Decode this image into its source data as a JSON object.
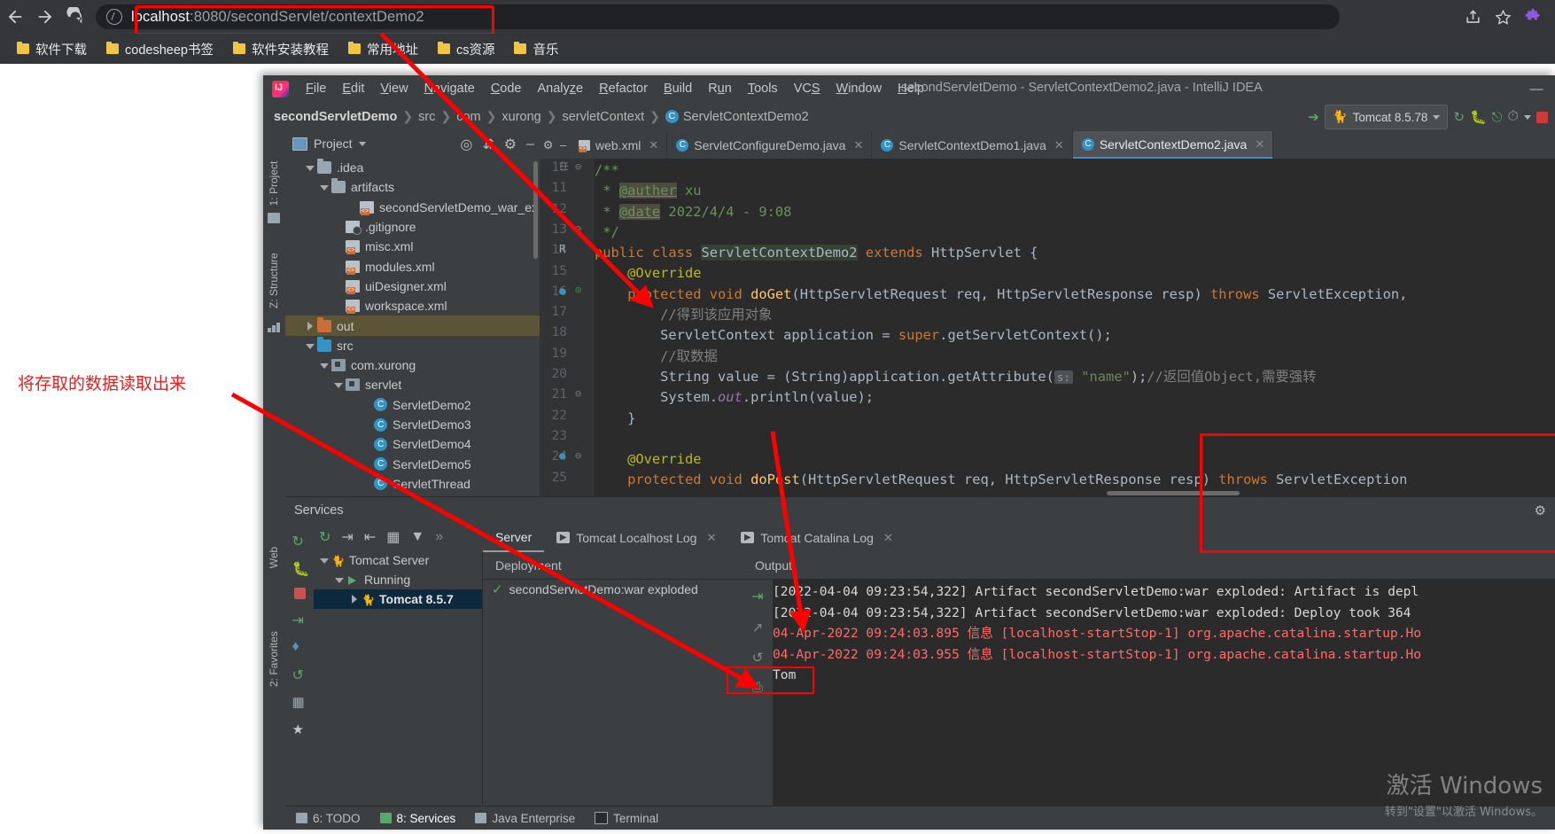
{
  "browser": {
    "back_icon": "back-arrow-icon",
    "forward_icon": "forward-arrow-icon",
    "reload_icon": "reload-icon",
    "url_host": "localhost",
    "url_rest": ":8080/secondServlet/contextDemo2",
    "share_icon": "share-icon",
    "bookmark_star_icon": "star-icon",
    "extensions_icon": "puzzle-icon",
    "bookmarks": [
      {
        "label": "软件下载"
      },
      {
        "label": "codesheep书签"
      },
      {
        "label": "软件安装教程"
      },
      {
        "label": "常用地址"
      },
      {
        "label": "cs资源"
      },
      {
        "label": "音乐"
      }
    ]
  },
  "ide": {
    "title": "secondServletDemo - ServletContextDemo2.java - IntelliJ IDEA",
    "minimize_label": "—",
    "menu": [
      {
        "label": "File",
        "mnemonic": "F"
      },
      {
        "label": "Edit",
        "mnemonic": "E"
      },
      {
        "label": "View",
        "mnemonic": "V"
      },
      {
        "label": "Navigate",
        "mnemonic": "N"
      },
      {
        "label": "Code",
        "mnemonic": "C"
      },
      {
        "label": "Analyze",
        "mnemonic": "z"
      },
      {
        "label": "Refactor",
        "mnemonic": "R"
      },
      {
        "label": "Build",
        "mnemonic": "B"
      },
      {
        "label": "Run",
        "mnemonic": "u"
      },
      {
        "label": "Tools",
        "mnemonic": "T"
      },
      {
        "label": "VCS",
        "mnemonic": "S"
      },
      {
        "label": "Window",
        "mnemonic": "W"
      },
      {
        "label": "Help",
        "mnemonic": "H"
      }
    ],
    "breadcrumb": [
      "secondServletDemo",
      "src",
      "com",
      "xurong",
      "servletContext",
      "ServletContextDemo2"
    ],
    "run_config": "Tomcat 8.5.78",
    "left_strips": [
      "1: Project",
      "Z: Structure"
    ],
    "bottom_left_strips": [
      "Web",
      "2: Favorites"
    ]
  },
  "project": {
    "title": "Project",
    "tree": [
      {
        "label": ".idea",
        "indent": 1,
        "arrow": "down",
        "icon": "folder"
      },
      {
        "label": "artifacts",
        "indent": 2,
        "arrow": "down",
        "icon": "folder"
      },
      {
        "label": "secondServletDemo_war_ex",
        "indent": 4,
        "arrow": "none",
        "icon": "xml"
      },
      {
        "label": ".gitignore",
        "indent": 3,
        "arrow": "none",
        "icon": "git"
      },
      {
        "label": "misc.xml",
        "indent": 3,
        "arrow": "none",
        "icon": "xml"
      },
      {
        "label": "modules.xml",
        "indent": 3,
        "arrow": "none",
        "icon": "xml"
      },
      {
        "label": "uiDesigner.xml",
        "indent": 3,
        "arrow": "none",
        "icon": "xml"
      },
      {
        "label": "workspace.xml",
        "indent": 3,
        "arrow": "none",
        "icon": "xml"
      },
      {
        "label": "out",
        "indent": 1,
        "arrow": "right",
        "icon": "folder-orange",
        "selected": true
      },
      {
        "label": "src",
        "indent": 1,
        "arrow": "down",
        "icon": "folder-blue"
      },
      {
        "label": "com.xurong",
        "indent": 2,
        "arrow": "down",
        "icon": "pkg"
      },
      {
        "label": "servlet",
        "indent": 3,
        "arrow": "down",
        "icon": "pkg"
      },
      {
        "label": "ServletDemo2",
        "indent": 5,
        "arrow": "none",
        "icon": "class"
      },
      {
        "label": "ServletDemo3",
        "indent": 5,
        "arrow": "none",
        "icon": "class"
      },
      {
        "label": "ServletDemo4",
        "indent": 5,
        "arrow": "none",
        "icon": "class"
      },
      {
        "label": "ServletDemo5",
        "indent": 5,
        "arrow": "none",
        "icon": "class"
      },
      {
        "label": "ServletThread",
        "indent": 5,
        "arrow": "none",
        "icon": "class"
      }
    ]
  },
  "editor": {
    "tabs": [
      {
        "label": "web.xml",
        "icon": "xml",
        "active": false
      },
      {
        "label": "ServletConfigureDemo.java",
        "icon": "class",
        "active": false
      },
      {
        "label": "ServletContextDemo1.java",
        "icon": "class",
        "active": false
      },
      {
        "label": "ServletContextDemo2.java",
        "icon": "class",
        "active": true
      }
    ],
    "first_line_number": 10,
    "lines": [
      {
        "n": 10,
        "text": "/**"
      },
      {
        "n": 11,
        "text": " * @auther xu"
      },
      {
        "n": 12,
        "text": " * @date 2022/4/4 - 9:08"
      },
      {
        "n": 13,
        "text": " */"
      },
      {
        "n": 14,
        "text": "public class ServletContextDemo2 extends HttpServlet {"
      },
      {
        "n": 15,
        "text": "    @Override"
      },
      {
        "n": 16,
        "text": "    protected void doGet(HttpServletRequest req, HttpServletResponse resp) throws ServletException,"
      },
      {
        "n": 17,
        "text": "        //得到该应用对象"
      },
      {
        "n": 18,
        "text": "        ServletContext application = super.getServletContext();"
      },
      {
        "n": 19,
        "text": "        //取数据"
      },
      {
        "n": 20,
        "text": "        String value = (String)application.getAttribute( s: \"name\");//返回值Object,需要强转"
      },
      {
        "n": 21,
        "text": "        System.out.println(value);"
      },
      {
        "n": 22,
        "text": "    }"
      },
      {
        "n": 23,
        "text": ""
      },
      {
        "n": 24,
        "text": "    @Override"
      },
      {
        "n": 25,
        "text": "    protected void doPost(HttpServletRequest req, HttpServletResponse resp) throws ServletException"
      }
    ]
  },
  "services": {
    "title": "Services",
    "tree": [
      {
        "label": "Tomcat Server",
        "indent": 0,
        "arrow": "down",
        "selected": false
      },
      {
        "label": "Running",
        "indent": 1,
        "arrow": "down",
        "selected": false
      },
      {
        "label": "Tomcat 8.5.7",
        "indent": 2,
        "arrow": "right",
        "selected": true
      }
    ],
    "tabs": [
      {
        "label": "Server",
        "active": true,
        "closable": false,
        "icon": false
      },
      {
        "label": "Tomcat Localhost Log",
        "active": false,
        "closable": true,
        "icon": true
      },
      {
        "label": "Tomcat Catalina Log",
        "active": false,
        "closable": true,
        "icon": true
      }
    ],
    "deployment_header": "Deployment",
    "deployment_item": "secondServletDemo:war exploded",
    "output_header": "Output",
    "console_lines": [
      {
        "text": "[2022-04-04 09:23:54,322] Artifact secondServletDemo:war exploded: Artifact is depl",
        "color": "normal"
      },
      {
        "text": "[2022-04-04 09:23:54,322] Artifact secondServletDemo:war exploded: Deploy took 364",
        "color": "normal"
      },
      {
        "text": "04-Apr-2022 09:24:03.895 信息 [localhost-startStop-1] org.apache.catalina.startup.Ho",
        "color": "red"
      },
      {
        "text": "04-Apr-2022 09:24:03.955 信息 [localhost-startStop-1] org.apache.catalina.startup.Ho",
        "color": "red"
      },
      {
        "text": "Tom",
        "color": "normal"
      }
    ]
  },
  "statusbar": [
    {
      "label": "6: TODO",
      "active": false
    },
    {
      "label": "8: Services",
      "active": true
    },
    {
      "label": "Java Enterprise",
      "active": false
    },
    {
      "label": "Terminal",
      "active": false
    }
  ],
  "annotations": {
    "note_text": "将存取的数据读取出来",
    "accent_color": "#ff0000"
  },
  "watermark": {
    "line1": "激活 Windows",
    "line2": "转到\"设置\"以激活 Windows。"
  }
}
